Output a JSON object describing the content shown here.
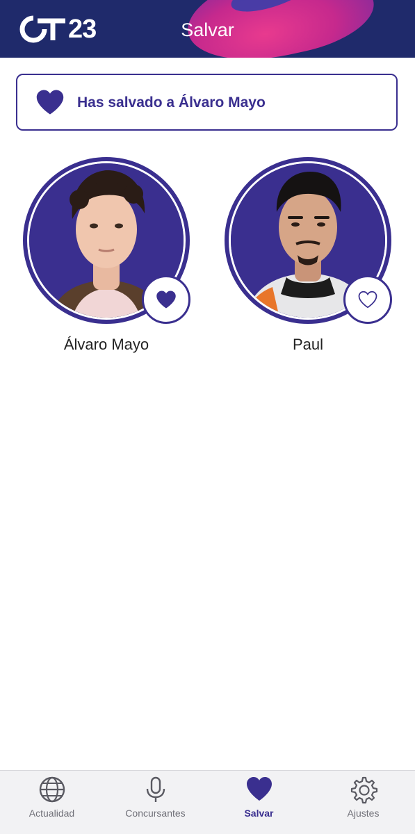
{
  "header": {
    "logo_text": "OT23",
    "title": "Salvar"
  },
  "banner": {
    "icon": "heart-filled-icon",
    "text": "Has salvado a Álvaro Mayo"
  },
  "contestants": [
    {
      "name": "Álvaro Mayo",
      "saved": true,
      "icon": "heart-filled-icon"
    },
    {
      "name": "Paul",
      "saved": false,
      "icon": "heart-outline-icon"
    }
  ],
  "bottom_nav": {
    "items": [
      {
        "label": "Actualidad",
        "icon": "globe-icon",
        "active": false
      },
      {
        "label": "Concursantes",
        "icon": "microphone-icon",
        "active": false
      },
      {
        "label": "Salvar",
        "icon": "heart-icon",
        "active": true
      },
      {
        "label": "Ajustes",
        "icon": "gear-icon",
        "active": false
      }
    ]
  },
  "colors": {
    "header_bg": "#1f2a6b",
    "accent": "#3a2f8f",
    "swoosh": "#e83a8e",
    "nav_bg": "#f2f2f4"
  }
}
